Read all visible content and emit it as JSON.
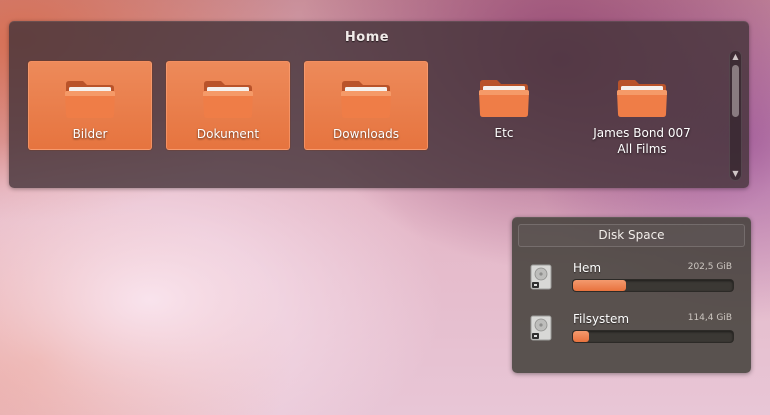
{
  "home_panel": {
    "title": "Home",
    "items": [
      {
        "label": "Bilder",
        "selected": true,
        "icon": "folder-icon"
      },
      {
        "label": "Dokument",
        "selected": true,
        "icon": "folder-icon"
      },
      {
        "label": "Downloads",
        "selected": true,
        "icon": "folder-icon"
      },
      {
        "label": "Etc",
        "selected": false,
        "icon": "folder-icon"
      },
      {
        "label": "James Bond 007\nAll Films",
        "selected": false,
        "icon": "folder-icon"
      }
    ],
    "scrollbar": {
      "up_arrow": "▲",
      "down_arrow": "▼"
    }
  },
  "disk_panel": {
    "title": "Disk Space",
    "drives": [
      {
        "name": "Hem",
        "size": "202,5 GiB",
        "used_fraction": 0.33,
        "icon": "hard-drive-icon"
      },
      {
        "name": "Filsystem",
        "size": "114,4 GiB",
        "used_fraction": 0.1,
        "icon": "hard-drive-icon"
      }
    ]
  },
  "colors": {
    "accent_orange": "#e6743f",
    "panel_dark": "#46343a"
  }
}
